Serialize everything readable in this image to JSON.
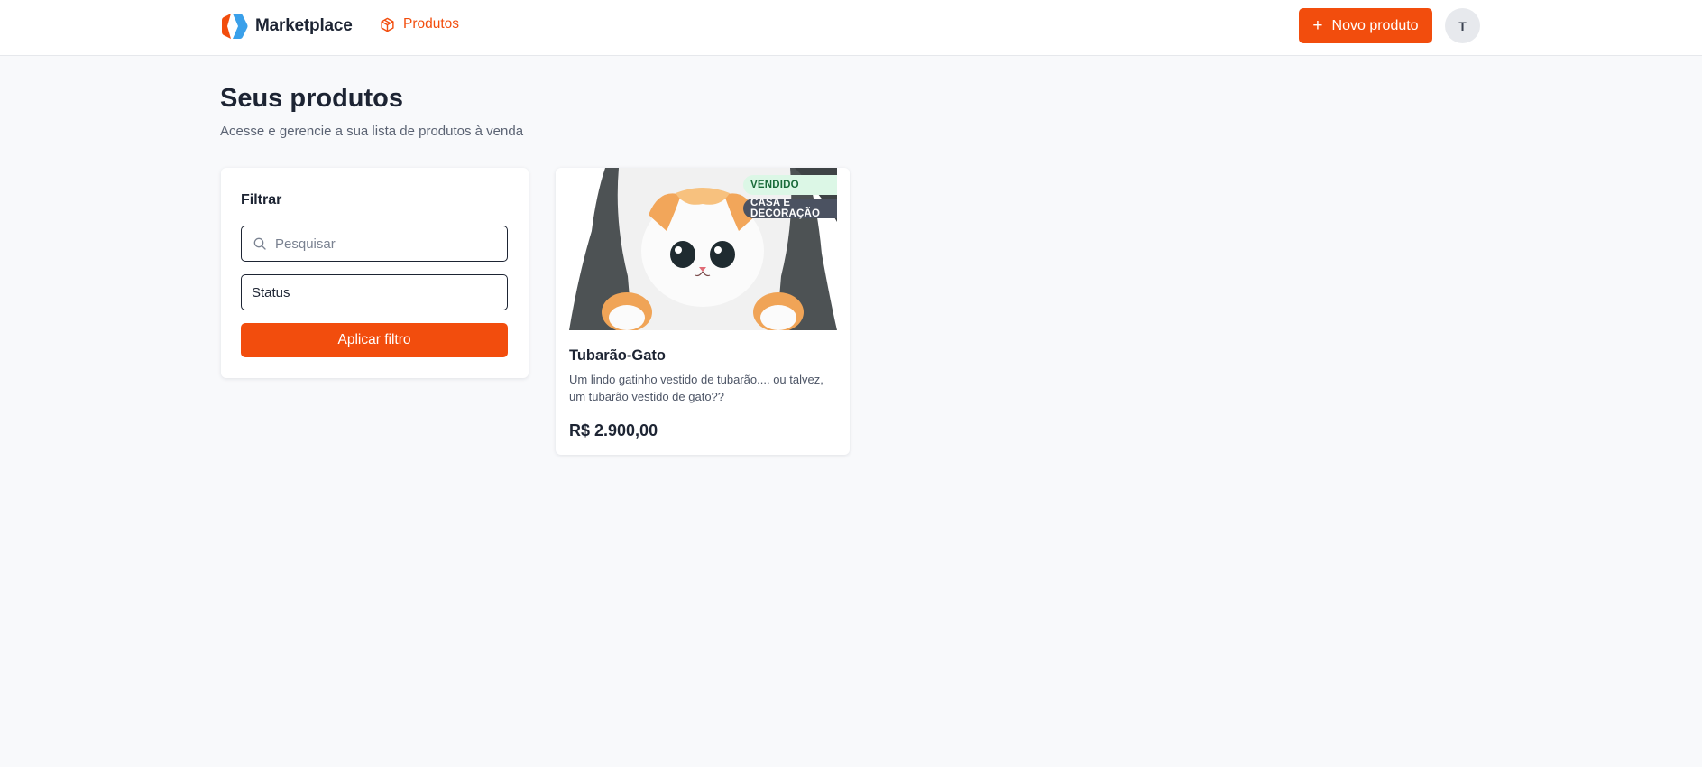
{
  "header": {
    "brand": "Marketplace",
    "nav_produtos": "Produtos",
    "new_product_label": "Novo produto",
    "avatar_initial": "T"
  },
  "page": {
    "title": "Seus produtos",
    "subtitle": "Acesse e gerencie a sua lista de produtos à venda"
  },
  "filter": {
    "title": "Filtrar",
    "search_placeholder": "Pesquisar",
    "search_value": "",
    "status_value": "Status",
    "apply_label": "Aplicar filtro"
  },
  "products": [
    {
      "name": "Tubarão-Gato",
      "description": "Um lindo gatinho vestido de tubarão.... ou talvez, um tubarão vestido de gato??",
      "price": "R$ 2.900,00",
      "status_badge": "VENDIDO",
      "category_badge": "CASA E DECORAÇÃO"
    }
  ],
  "colors": {
    "accent": "#f24d0d",
    "brand_blue": "#3aa0ea",
    "background": "#f8f9fb",
    "status_sold_bg": "#dcf7e6",
    "category_bg": "#4b5261"
  },
  "icons": {
    "logo": "marketplace-logo-icon",
    "nav": "package-icon",
    "new": "plus-icon",
    "search": "search-icon"
  }
}
